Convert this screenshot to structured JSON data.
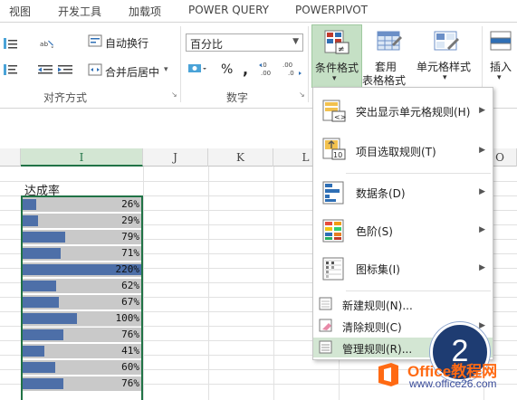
{
  "ribbon_tabs": [
    "视图",
    "开发工具",
    "加载项",
    "POWER QUERY",
    "POWERPIVOT"
  ],
  "alignment": {
    "wrap_text_label": "自动换行",
    "merge_center_label": "合并后居中",
    "group_label": "对齐方式"
  },
  "number": {
    "format_value": "百分比",
    "percent_symbol": "%",
    "comma_symbol": ",",
    "group_label": "数字"
  },
  "styles": {
    "conditional_formatting_label": "条件格式",
    "format_as_table_label_1": "套用",
    "format_as_table_label_2": "表格格式",
    "cell_styles_label": "单元格样式",
    "insert_label": "插入"
  },
  "columns": [
    "I",
    "J",
    "K",
    "L",
    "O"
  ],
  "sheet": {
    "title": "达成率",
    "rows": [
      {
        "pct": "26%",
        "value": 0.26
      },
      {
        "pct": "29%",
        "value": 0.29
      },
      {
        "pct": "79%",
        "value": 0.79
      },
      {
        "pct": "71%",
        "value": 0.71
      },
      {
        "pct": "220%",
        "value": 2.2
      },
      {
        "pct": "62%",
        "value": 0.62
      },
      {
        "pct": "67%",
        "value": 0.67
      },
      {
        "pct": "100%",
        "value": 1.0
      },
      {
        "pct": "76%",
        "value": 0.76
      },
      {
        "pct": "41%",
        "value": 0.41
      },
      {
        "pct": "60%",
        "value": 0.6
      },
      {
        "pct": "76%",
        "value": 0.76
      }
    ],
    "max_value": 2.2,
    "bar_color": "#4d6fa8",
    "cell_bg": "#c9c9c9"
  },
  "menu": {
    "highlight_rules": "突出显示单元格规则(H)",
    "top_bottom_rules": "项目选取规则(T)",
    "data_bars": "数据条(D)",
    "color_scales": "色阶(S)",
    "icon_sets": "图标集(I)",
    "new_rule": "新建规则(N)...",
    "clear_rules": "清除规则(C)",
    "manage_rules": "管理规则(R)..."
  },
  "step_badge": "2",
  "watermark": {
    "brand": "Office教程网",
    "url": "www.office26.com"
  },
  "colors": {
    "accent_green": "#217346",
    "highlight": "#d3e6d3",
    "badge": "#1e3c72",
    "brand_orange": "#ff6a13"
  }
}
